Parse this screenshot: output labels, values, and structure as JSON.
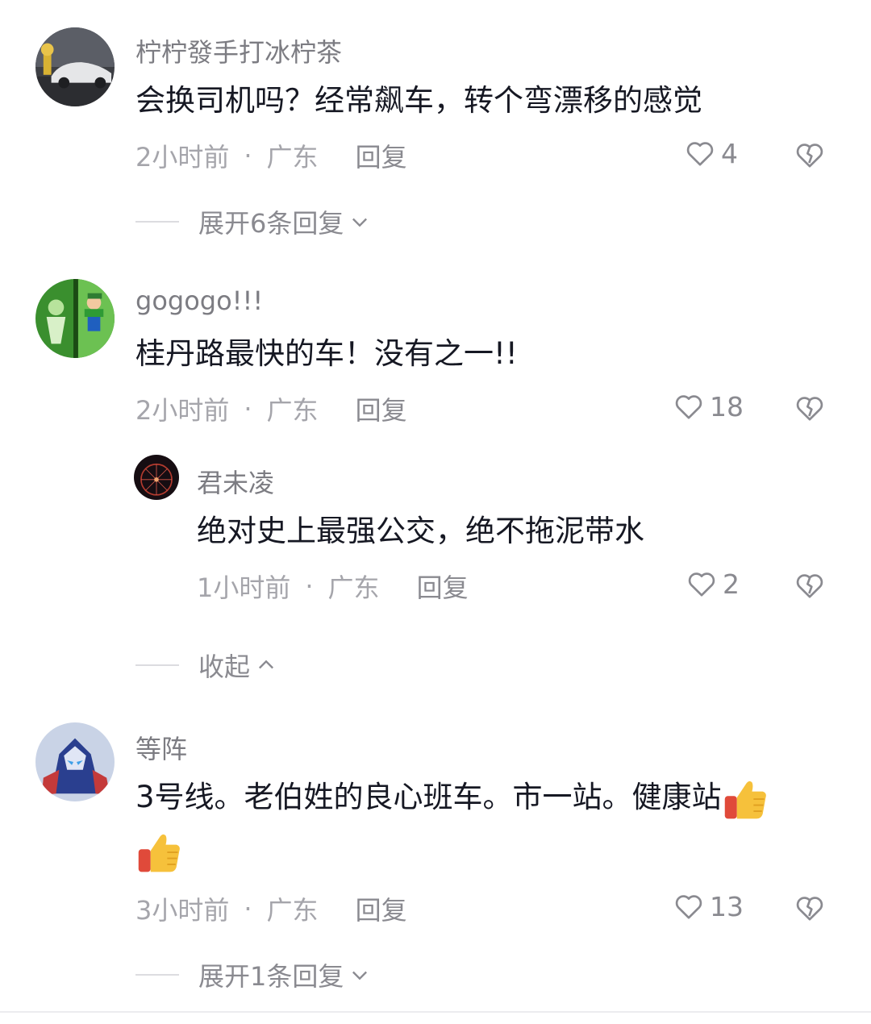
{
  "comments": [
    {
      "username": "柠柠發手打冰柠茶",
      "text": "会换司机吗？经常飙车，转个弯漂移的感觉",
      "time": "2小时前",
      "location": "广东",
      "reply_label": "回复",
      "likes": "4",
      "expand_label": "展开6条回复",
      "avatar_icon": "car-photo-avatar"
    },
    {
      "username": "gogogo!!!",
      "text": "桂丹路最快的车！没有之一!!",
      "time": "2小时前",
      "location": "广东",
      "reply_label": "回复",
      "likes": "18",
      "avatar_icon": "game-character-avatar",
      "reply": {
        "username": "君未凌",
        "text": "绝对史上最强公交，绝不拖泥带水",
        "time": "1小时前",
        "location": "广东",
        "reply_label": "回复",
        "likes": "2",
        "avatar_icon": "ferris-wheel-avatar"
      },
      "collapse_label": "收起"
    },
    {
      "username": "等阵",
      "text_line1": "3号线。老伯姓的良心班车。市一站。健康站",
      "time": "3小时前",
      "location": "广东",
      "reply_label": "回复",
      "likes": "13",
      "expand_label": "展开1条回复",
      "avatar_icon": "hero-character-avatar",
      "emoji": "thumbs-up-emoji"
    }
  ],
  "separator": "·",
  "colors": {
    "text_primary": "#161823",
    "text_secondary": "#8a8a90",
    "meta": "#a5a5ab"
  }
}
